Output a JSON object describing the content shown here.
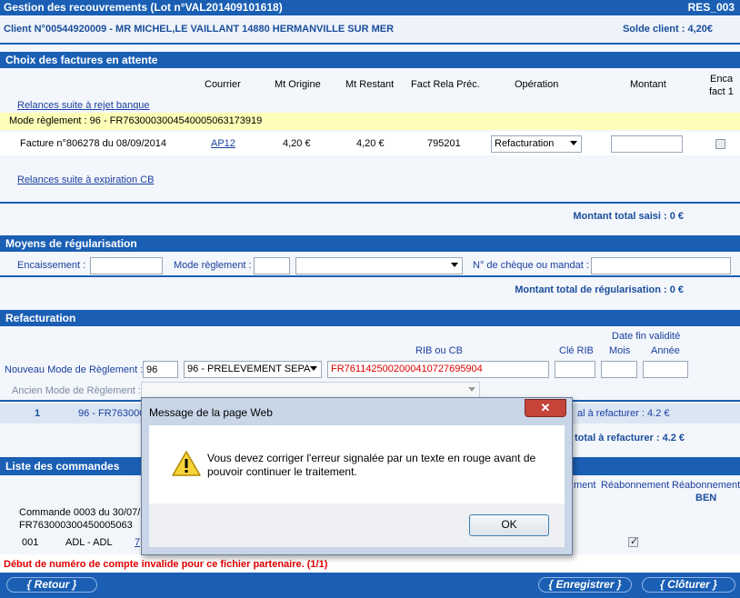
{
  "header": {
    "title": "Gestion des recouvrements (Lot n°VAL201409101618)",
    "code": "RES_003"
  },
  "client": {
    "info": "Client N°00544920009 - MR MICHEL,LE VAILLANT 14880 HERMANVILLE SUR MER",
    "solde": "Solde client : 4,20€"
  },
  "factures": {
    "title": "Choix des factures en attente",
    "columns": {
      "courrier": "Courrier",
      "mt_origine": "Mt Origine",
      "mt_restant": "Mt Restant",
      "fact_rela": "Fact Rela Préc.",
      "operation": "Opération",
      "montant": "Montant",
      "enca_line1": "Enca",
      "enca_line2": "fact 1"
    },
    "link_rejet": "Relances suite à rejet banque",
    "mode_reglement": "Mode règlement : 96 - FR7630003004540005063173919",
    "row": {
      "label": "Facture n°806278 du 08/09/2014",
      "courrier": "AP12",
      "mt_origine": "4,20 €",
      "mt_restant": "4,20 €",
      "fact_rela": "795201",
      "operation": "Refacturation",
      "montant": ""
    },
    "link_expiration": "Relances suite à expiration CB",
    "total": "Montant total saisi : 0 €"
  },
  "moyens": {
    "title": "Moyens de régularisation",
    "encaissement_label": "Encaissement :",
    "mode_label": "Mode règlement :",
    "cheque_label": "N° de chèque ou mandat :",
    "total": "Montant total de régularisation : 0 €"
  },
  "refacturation": {
    "title": "Refacturation",
    "date_fin": "Date fin validité",
    "rib_label": "RIB ou CB",
    "cle_rib": "Clé RIB",
    "mois": "Mois",
    "annee": "Année",
    "nouveau_label": "Nouveau Mode de Règlement :",
    "nouveau_code": "96",
    "nouveau_select": "96 - PRELEVEMENT SEPA",
    "rib_value": "FR7611425002000410727695904",
    "ancien_label": "Ancien Mode de Règlement :",
    "line_num": "1",
    "line_text": "96 - FR763000",
    "line_total": "al à refacturer : 4.2 €",
    "total": "total à refacturer : 4.2 €"
  },
  "commandes": {
    "title": "Liste des commandes",
    "col_ment": "ment",
    "col_reab": "Réabonnement",
    "col_reab_ben1": "Réabonnement",
    "col_reab_ben2": "BEN",
    "cmd_line1": "Commande 0003 du 30/07/2",
    "cmd_line2": "FR763000300450005063",
    "item_num": "001",
    "item_label": "ADL - ADL",
    "item_link": "7"
  },
  "error": "Début de numéro de compte invalide pour ce fichier partenaire. (1/1)",
  "buttons": {
    "retour": "Retour",
    "enregistrer": "Enregistrer",
    "cloturer": "Clôturer"
  },
  "dialog": {
    "title": "Message de la page Web",
    "close": "✕",
    "message": "Vous devez corriger l'erreur signalée par un texte en rouge avant de pouvoir continuer le traitement.",
    "ok": "OK"
  },
  "colors": {
    "bar": "#1a5fb4",
    "error": "#e00000",
    "highlight": "#fefeb8"
  }
}
